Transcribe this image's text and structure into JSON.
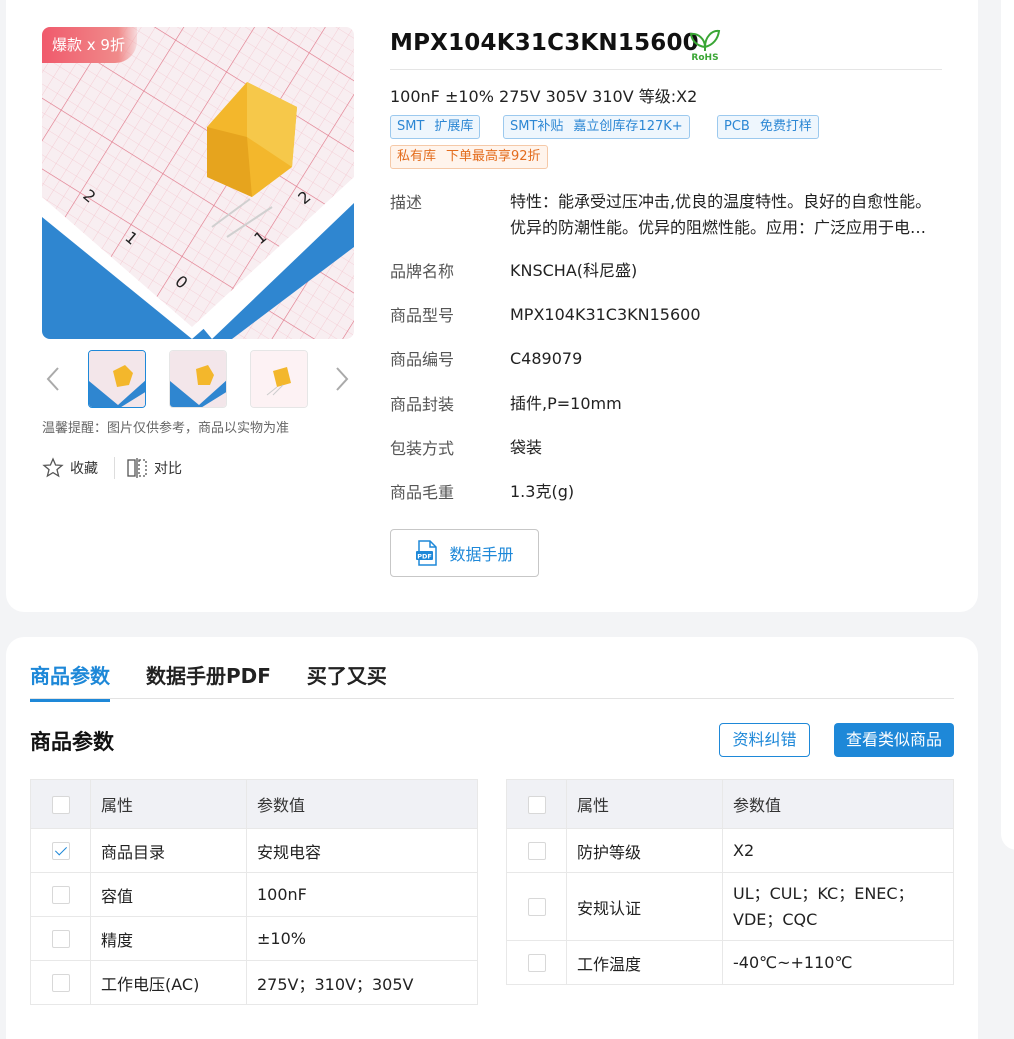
{
  "promo": {
    "badge": "爆款 x 9折"
  },
  "gallery": {
    "tip": "温馨提醒：图片仅供参考，商品以实物为准",
    "actions": {
      "favorite": "收藏",
      "compare": "对比"
    }
  },
  "product": {
    "title": "MPX104K31C3KN15600",
    "rohs_label": "RoHS",
    "subtitle": "100nF ±10% 275V 305V 310V 等级:X2",
    "tags": [
      {
        "key": "SMT",
        "value": "扩展库"
      },
      {
        "key": "SMT补贴",
        "value": "嘉立创库存127K+"
      },
      {
        "key": "PCB",
        "value": "免费打样"
      },
      {
        "key": "私有库",
        "value": "下单最高享92折"
      }
    ],
    "attributes": [
      {
        "label": "描述",
        "value": "特性：能承受过压冲击,优良的温度特性。良好的自愈性能。优异的防潮性能。优异的阻燃性能。应用：广泛应用于电源跨线电路、抗干扰电路等。"
      },
      {
        "label": "品牌名称",
        "value": "KNSCHA(科尼盛)"
      },
      {
        "label": "商品型号",
        "value": "MPX104K31C3KN15600"
      },
      {
        "label": "商品编号",
        "value": "C489079"
      },
      {
        "label": "商品封装",
        "value": "插件,P=10mm"
      },
      {
        "label": "包装方式",
        "value": "袋装"
      },
      {
        "label": "商品毛重",
        "value": "1.3克(g)"
      }
    ],
    "datasheet_button": "数据手册",
    "pdf_icon_label": "PDF"
  },
  "tabs": [
    "商品参数",
    "数据手册PDF",
    "买了又买"
  ],
  "params": {
    "title": "商品参数",
    "report_button": "资料纠错",
    "similar_button": "查看类似商品",
    "header": {
      "attr": "属性",
      "value": "参数值"
    },
    "left_rows": [
      {
        "attr": "商品目录",
        "value": "安规电容",
        "checked": true
      },
      {
        "attr": "容值",
        "value": "100nF",
        "checked": false
      },
      {
        "attr": "精度",
        "value": "±10%",
        "checked": false
      },
      {
        "attr": "工作电压(AC)",
        "value": "275V；310V；305V",
        "checked": false
      }
    ],
    "right_rows": [
      {
        "attr": "防护等级",
        "value": "X2",
        "checked": false
      },
      {
        "attr": "安规认证",
        "value": "UL；CUL；KC；ENEC；VDE；CQC",
        "checked": false
      },
      {
        "attr": "工作温度",
        "value": "-40℃~+110℃",
        "checked": false
      }
    ]
  },
  "colors": {
    "accent": "#1e88d8",
    "promo": "#f05a6c",
    "orange_tag": "#e36c1d",
    "rohs_green": "#3aa635"
  }
}
